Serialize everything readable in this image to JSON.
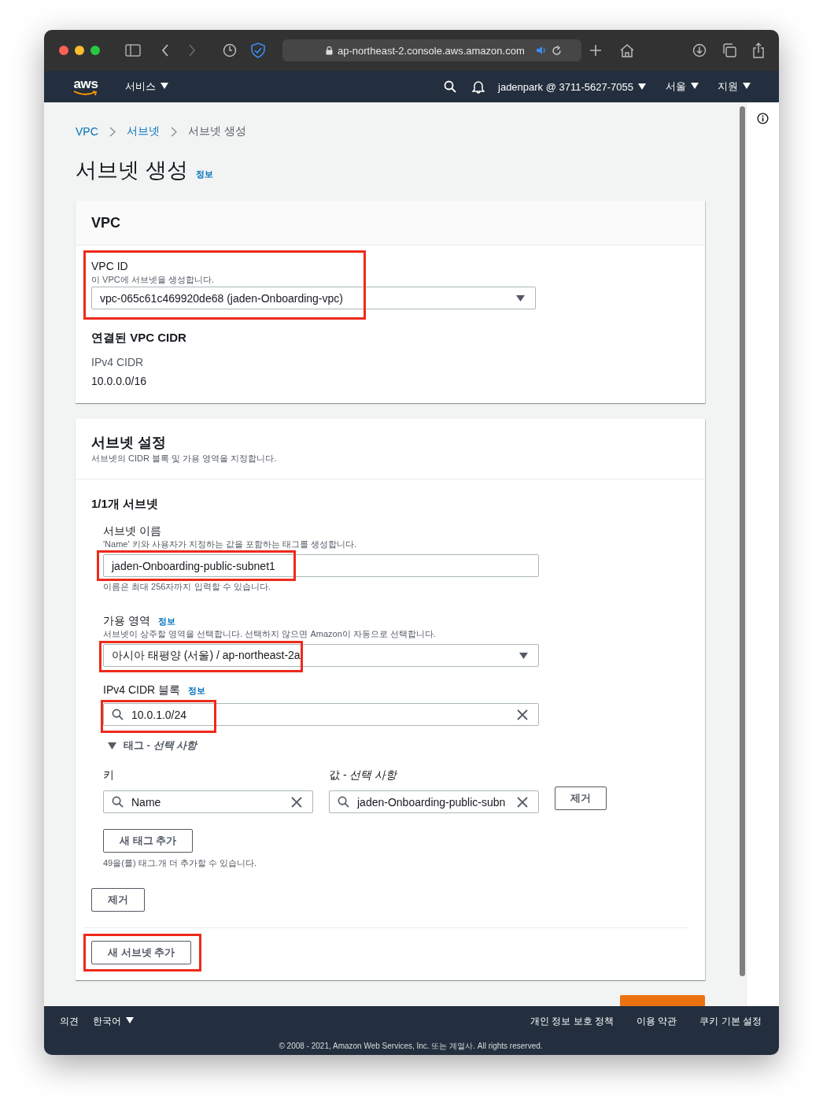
{
  "browser": {
    "url": "ap-northeast-2.console.aws.amazon.com"
  },
  "nav": {
    "logo": "aws",
    "services": "서비스",
    "account": "jadenpark @ 3711-5627-7055",
    "region": "서울",
    "support": "지원"
  },
  "breadcrumbs": [
    {
      "label": "VPC",
      "link": true
    },
    {
      "label": "서브넷",
      "link": true
    },
    {
      "label": "서브넷 생성",
      "link": false
    }
  ],
  "page": {
    "title": "서브넷 생성",
    "info": "정보"
  },
  "vpc_card": {
    "title": "VPC",
    "field": {
      "label": "VPC ID",
      "description": "이 VPC에 서브넷을 생성합니다.",
      "value": "vpc-065c61c469920de68 (jaden-Onboarding-vpc)",
      "highlighted": true
    },
    "cidr": {
      "heading": "연결된 VPC CIDR",
      "label": "IPv4 CIDR",
      "value": "10.0.0.0/16"
    }
  },
  "subnet_card": {
    "title": "서브넷 설정",
    "description": "서브넷의 CIDR 블록 및 가용 영역을 지정합니다.",
    "subnet": {
      "heading": "1/1개 서브넷",
      "name_field": {
        "label": "서브넷 이름",
        "description": "'Name' 키와 사용자가 지정하는 값을 포함하는 태그를 생성합니다.",
        "value": "jaden-Onboarding-public-subnet1",
        "hint": "이름은 최대 256자까지 입력할 수 있습니다.",
        "highlighted": true
      },
      "az_field": {
        "label": "가용 영역",
        "info": "정보",
        "description": "서브넷이 상주할 영역을 선택합니다. 선택하지 않으면 Amazon이 자동으로 선택합니다.",
        "value": "아시아 태평양 (서울) / ap-northeast-2a",
        "highlighted": true
      },
      "cidr_field": {
        "label": "IPv4 CIDR 블록",
        "info": "정보",
        "value": "10.0.1.0/24",
        "highlighted": true
      },
      "tags": {
        "toggle": "태그 - *선택 사항*",
        "expanded": true,
        "key_label": "키",
        "value_label": "값 - *선택 사항*",
        "rows": [
          {
            "key": "Name",
            "value": "jaden-Onboarding-public-subn",
            "remove": "제거"
          }
        ],
        "add_button": "새 태그 추가",
        "limit_note": "49을(를) 태그.개 더 추가할 수 있습니다."
      },
      "remove_button": "제거"
    },
    "add_subnet_button": {
      "label": "새 서브넷 추가",
      "highlighted": true
    }
  },
  "footer": {
    "feedback": "의견",
    "language": "한국어",
    "links": [
      "개인 정보 보호 정책",
      "이용 약관",
      "쿠키 기본 설정"
    ],
    "copyright": "© 2008 - 2021, Amazon Web Services, Inc. 또는 계열사. All rights reserved."
  }
}
